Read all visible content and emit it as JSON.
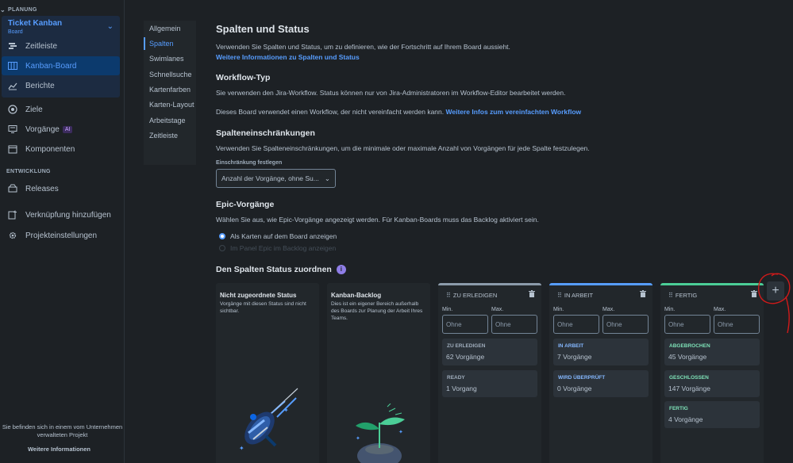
{
  "sidebar": {
    "section_planning": "PLANUNG",
    "project": {
      "name": "Ticket Kanban",
      "sub": "Board"
    },
    "items": [
      {
        "label": "Zeitleiste",
        "icon": "timeline-icon"
      },
      {
        "label": "Kanban-Board",
        "icon": "board-icon"
      },
      {
        "label": "Berichte",
        "icon": "reports-icon"
      },
      {
        "label": "Ziele",
        "icon": "goals-icon"
      },
      {
        "label": "Vorgänge",
        "icon": "issues-icon",
        "badge": "AI"
      },
      {
        "label": "Komponenten",
        "icon": "components-icon"
      }
    ],
    "section_dev": "ENTWICKLUNG",
    "dev_items": [
      {
        "label": "Releases",
        "icon": "releases-icon"
      }
    ],
    "extra_items": [
      {
        "label": "Verknüpfung hinzufügen",
        "icon": "add-shortcut-icon"
      },
      {
        "label": "Projekteinstellungen",
        "icon": "settings-gear-icon"
      }
    ],
    "footer_text": "Sie befinden sich in einem vom Unternehmen verwalteten Projekt",
    "footer_link": "Weitere Informationen"
  },
  "settings_nav": [
    "Allgemein",
    "Spalten",
    "Swimlanes",
    "Schnellsuche",
    "Kartenfarben",
    "Karten-Layout",
    "Arbeitstage",
    "Zeitleiste"
  ],
  "page": {
    "title": "Spalten und Status",
    "intro": "Verwenden Sie Spalten und Status, um zu definieren, wie der Fortschritt auf Ihrem Board aussieht.",
    "intro_link": "Weitere Informationen zu Spalten und Status",
    "workflow_title": "Workflow-Typ",
    "workflow_text": "Sie verwenden den Jira-Workflow. Status können nur von Jira-Administratoren im Workflow-Editor bearbeitet werden.",
    "workflow_text2": "Dieses Board verwendet einen Workflow, der nicht vereinfacht werden kann. ",
    "workflow_link": "Weitere Infos zum vereinfachten Workflow",
    "constraint_title": "Spalteneinschränkungen",
    "constraint_text": "Verwenden Sie Spalteneinschränkungen, um die minimale oder maximale Anzahl von Vorgängen für jede Spalte festzulegen.",
    "constraint_label": "Einschränkung festlegen",
    "constraint_value": "Anzahl der Vorgänge, ohne Su...",
    "epic_title": "Epic-Vorgänge",
    "epic_text": "Wählen Sie aus, wie Epic-Vorgänge angezeigt werden. Für Kanban-Boards muss das Backlog aktiviert sein.",
    "epic_opt1": "Als Karten auf dem Board anzeigen",
    "epic_opt2": "Im Panel Epic im Backlog anzeigen",
    "map_title": "Den Spalten Status zuordnen"
  },
  "columns": {
    "unassigned": {
      "title": "Nicht zugeordnete Status",
      "desc": "Vorgänge mit diesen Status sind nicht sichtbar."
    },
    "backlog": {
      "title": "Kanban-Backlog",
      "desc": "Dies ist ein eigener Bereich außerhalb des Boards zur Planung der Arbeit Ihres Teams."
    },
    "min_label": "Min.",
    "max_label": "Max.",
    "placeholder": "Ohne",
    "board": [
      {
        "name": "ZU ERLEDIGEN",
        "color": "#8c9bab",
        "cards": [
          {
            "status": "ZU ERLEDIGEN",
            "count": "62 Vorgänge",
            "color": "#9fadbc"
          },
          {
            "status": "READY",
            "count": "1 Vorgang",
            "color": "#9fadbc"
          }
        ]
      },
      {
        "name": "IN ARBEIT",
        "color": "#579dff",
        "cards": [
          {
            "status": "IN ARBEIT",
            "count": "7 Vorgänge",
            "color": "#85b8ff"
          },
          {
            "status": "WIRD ÜBERPRÜFT",
            "count": "0 Vorgänge",
            "color": "#85b8ff"
          }
        ]
      },
      {
        "name": "FERTIG",
        "color": "#4bce97",
        "cards": [
          {
            "status": "ABGEBROCHEN",
            "count": "45 Vorgänge",
            "color": "#7ee2b8"
          },
          {
            "status": "GESCHLOSSEN",
            "count": "147 Vorgänge",
            "color": "#7ee2b8"
          },
          {
            "status": "FERTIG",
            "count": "4 Vorgänge",
            "color": "#7ee2b8"
          }
        ]
      }
    ]
  },
  "add_column": "+"
}
